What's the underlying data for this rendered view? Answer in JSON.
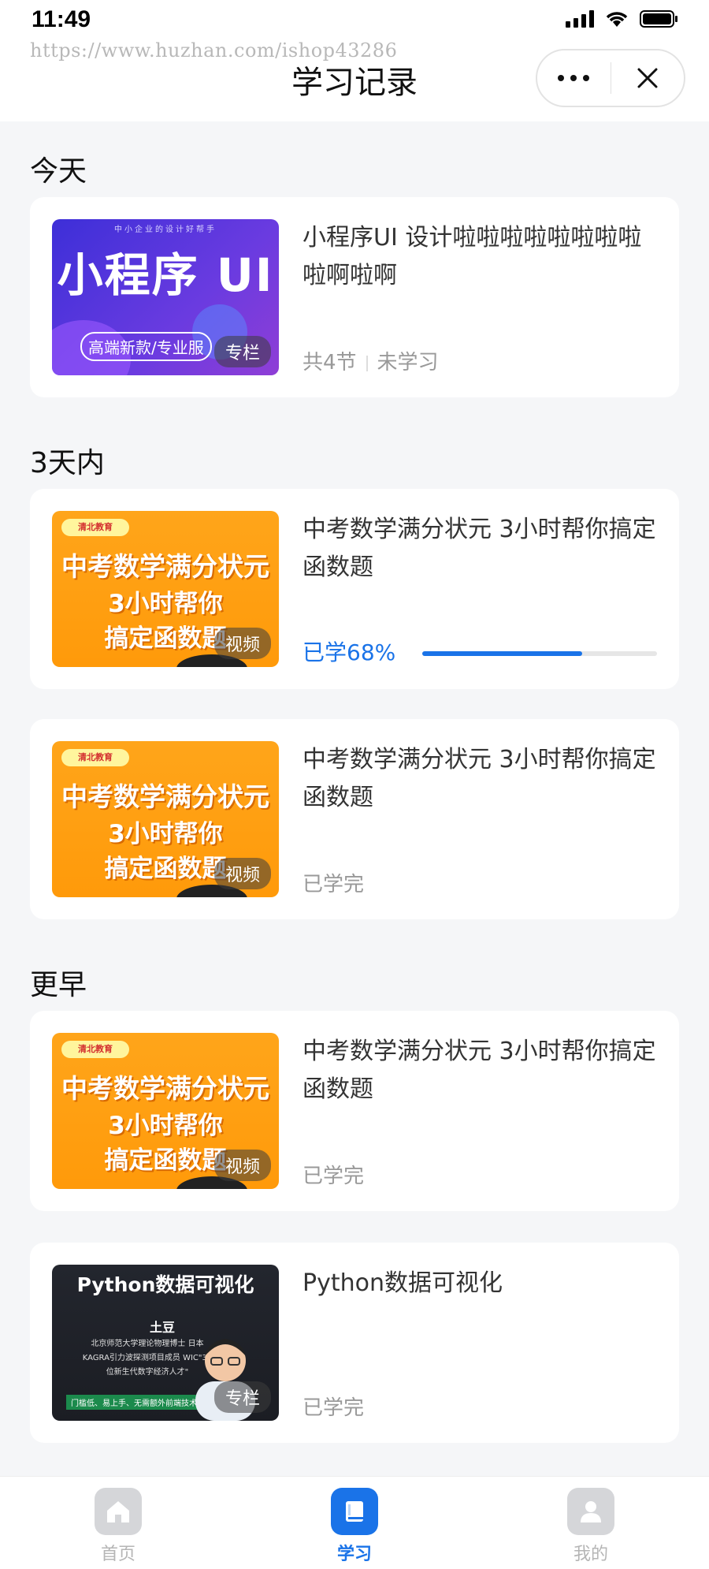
{
  "status_bar": {
    "time": "11:49"
  },
  "watermark": "https://www.huzhan.com/ishop43286",
  "header": {
    "title": "学习记录"
  },
  "sections": [
    {
      "title": "今天",
      "items": [
        {
          "title": "小程序UI 设计啦啦啦啦啦啦啦啦啦啊啦啊",
          "tag": "专栏",
          "lessons": "共4节",
          "status": "未学习",
          "thumb": {
            "top": "中小企业的设计好帮手",
            "big": "小程序 UI",
            "sub": "高端新款/专业服"
          }
        }
      ]
    },
    {
      "title": "3天内",
      "items": [
        {
          "title": "中考数学满分状元  3小时帮你搞定函数题",
          "tag": "视频",
          "progress_label": "已学68%",
          "progress": 0.68,
          "thumb": {
            "logo": "清北教育",
            "l1": "中考数学满分状元",
            "l2": "3小时帮你",
            "l3": "搞定函数题"
          }
        },
        {
          "title": "中考数学满分状元  3小时帮你搞定函数题",
          "tag": "视频",
          "status": "已学完",
          "thumb": {
            "logo": "清北教育",
            "l1": "中考数学满分状元",
            "l2": "3小时帮你",
            "l3": "搞定函数题"
          }
        }
      ]
    },
    {
      "title": "更早",
      "items": [
        {
          "title": "中考数学满分状元  3小时帮你搞定函数题",
          "tag": "视频",
          "status": "已学完",
          "thumb": {
            "logo": "清北教育",
            "l1": "中考数学满分状元",
            "l2": "3小时帮你",
            "l3": "搞定函数题"
          }
        },
        {
          "title": "Python数据可视化",
          "tag": "专栏",
          "status": "已学完",
          "thumb": {
            "title": "Python数据可视化",
            "name": "土豆",
            "desc": "北京师范大学理论物理博士 日本KAGRA引力波探测项目成员 WIC\"30位新生代数字经济人才\"",
            "green": "门槛低、易上手、无需额外前端技术"
          }
        }
      ]
    }
  ],
  "tabbar": {
    "items": [
      {
        "label": "首页",
        "icon": "home-icon",
        "active": false
      },
      {
        "label": "学习",
        "icon": "book-icon",
        "active": true
      },
      {
        "label": "我的",
        "icon": "user-icon",
        "active": false
      }
    ],
    "active_color": "#1a73e8"
  },
  "colors": {
    "accent": "#1a73e8",
    "background": "#f5f6f8",
    "thumb_orange": "#ffa51a"
  }
}
